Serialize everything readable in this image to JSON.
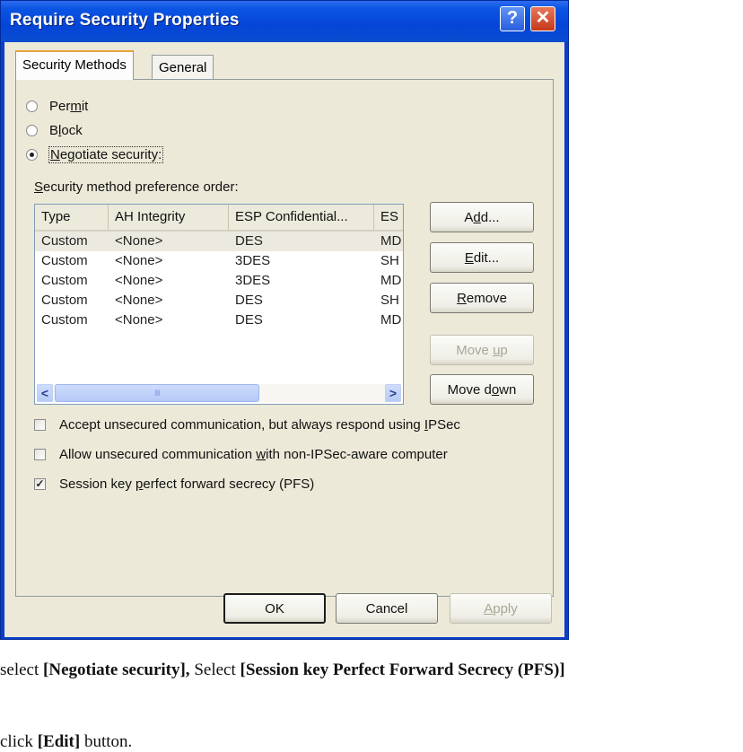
{
  "window": {
    "title": "Require Security Properties",
    "help_glyph": "?",
    "close_glyph": "✕"
  },
  "tabs": [
    {
      "label": "Security Methods",
      "active": true
    },
    {
      "label": "General",
      "active": false
    }
  ],
  "radios": {
    "permit": {
      "pre": "Per",
      "accel": "m",
      "post": "it",
      "checked": false
    },
    "block": {
      "pre": "B",
      "accel": "l",
      "post": "ock",
      "checked": false
    },
    "negotiate": {
      "pre": "",
      "accel": "N",
      "post": "egotiate security:",
      "checked": true
    }
  },
  "list_label": {
    "accel": "S",
    "post": "ecurity method preference order:"
  },
  "list": {
    "columns": [
      "Type",
      "AH Integrity",
      "ESP Confidential...",
      "ES"
    ],
    "rows": [
      [
        "Custom",
        "<None>",
        "DES",
        "MD"
      ],
      [
        "Custom",
        "<None>",
        "3DES",
        "SH"
      ],
      [
        "Custom",
        "<None>",
        "3DES",
        "MD"
      ],
      [
        "Custom",
        "<None>",
        "DES",
        "SH"
      ],
      [
        "Custom",
        "<None>",
        "DES",
        "MD"
      ]
    ],
    "selected_row": 0,
    "scroll_left": "<",
    "scroll_right": ">",
    "thumb_grip": "IIII"
  },
  "side_buttons": {
    "add": {
      "pre": "A",
      "accel": "d",
      "post": "d...",
      "enabled": true
    },
    "edit": {
      "pre": "",
      "accel": "E",
      "post": "dit...",
      "enabled": true
    },
    "remove": {
      "pre": "",
      "accel": "R",
      "post": "emove",
      "enabled": true
    },
    "move_up": {
      "pre": "Move ",
      "accel": "u",
      "post": "p",
      "enabled": false
    },
    "move_down": {
      "pre": "Move d",
      "accel": "o",
      "post": "wn",
      "enabled": true
    }
  },
  "checkboxes": {
    "accept": {
      "pre": "Accept unsecured communication, but always respond using ",
      "accel": "I",
      "post": "PSec",
      "checked": false
    },
    "allow": {
      "pre": "Allow unsecured communication ",
      "accel": "w",
      "post": "ith non-IPSec-aware computer",
      "checked": false
    },
    "pfs": {
      "pre": "Session key ",
      "accel": "p",
      "post": "erfect forward secrecy (PFS)",
      "checked": true,
      "mark": "✓"
    }
  },
  "footer": {
    "ok": "OK",
    "cancel": "Cancel",
    "apply": {
      "pre": "",
      "accel": "A",
      "post": "pply",
      "enabled": false
    }
  },
  "caption": {
    "line1": [
      {
        "text": "select ",
        "bold": false
      },
      {
        "text": "[Negotiate security],",
        "bold": true
      },
      {
        "text": " Select ",
        "bold": false
      },
      {
        "text": "[Session key Perfect Forward Secrecy (PFS)]",
        "bold": true
      }
    ],
    "line2": [
      {
        "text": "click ",
        "bold": false
      },
      {
        "text": "[Edit]",
        "bold": true
      },
      {
        "text": " button.",
        "bold": false
      }
    ]
  }
}
